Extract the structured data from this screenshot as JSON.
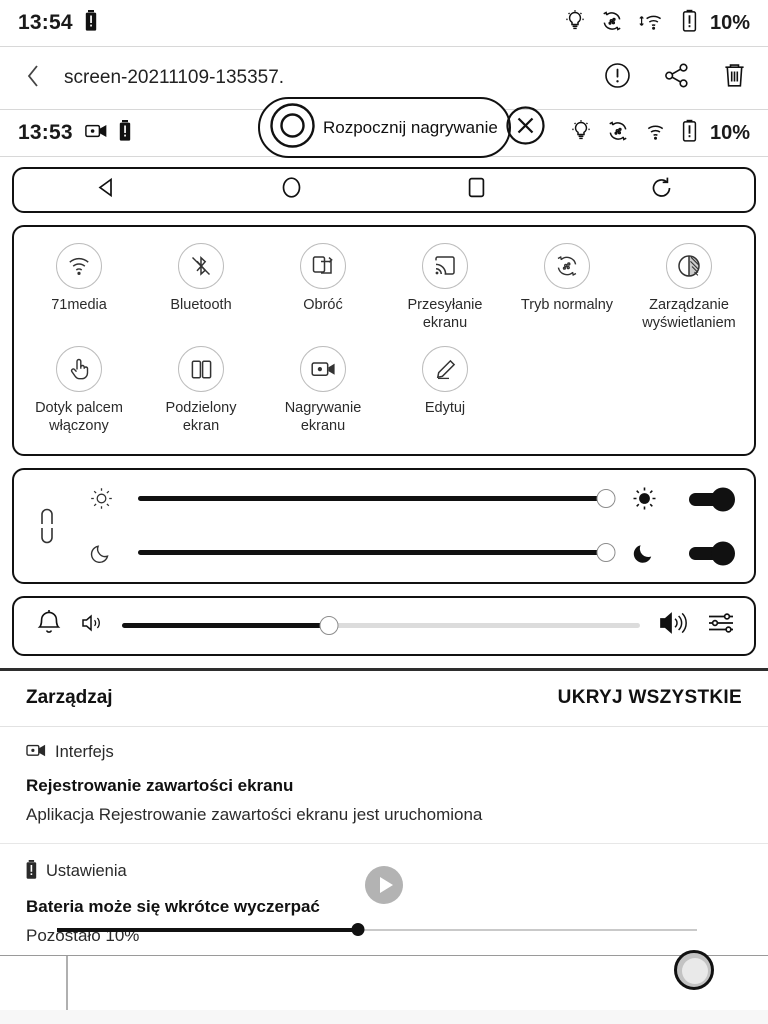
{
  "status_bar_top": {
    "time": "13:54",
    "battery_percent": "10%",
    "icons": [
      "battery-alert-icon",
      "bulb-icon",
      "refresh-mode-icon",
      "wifi-transfer-icon",
      "battery-alert-icon"
    ]
  },
  "toolbar": {
    "back_icon": "chevron-left-icon",
    "title": "screen-20211109-135357.",
    "actions": [
      "info-icon",
      "share-icon",
      "delete-icon"
    ]
  },
  "record_pill": {
    "record_icon": "record-circle-icon",
    "label": "Rozpocznij nagrywanie",
    "close_icon": "close-circle-icon"
  },
  "status_bar_second": {
    "time": "13:53",
    "battery_percent": "10%",
    "left_icons": [
      "screen-record-icon",
      "battery-alert-icon"
    ],
    "right_icons": [
      "bulb-icon",
      "refresh-mode-icon",
      "wifi-icon",
      "battery-alert-icon"
    ]
  },
  "nav_bar": {
    "items": [
      {
        "name": "back-nav-icon"
      },
      {
        "name": "home-nav-icon"
      },
      {
        "name": "recents-nav-icon"
      },
      {
        "name": "refresh-nav-icon"
      }
    ]
  },
  "quick_tiles": [
    {
      "label": "71media",
      "icon": "wifi-icon"
    },
    {
      "label": "Bluetooth",
      "icon": "bluetooth-off-icon"
    },
    {
      "label": "Obróć",
      "icon": "rotate-screen-icon"
    },
    {
      "label": "Przesyłanie\nekranu",
      "label_l1": "Przesyłanie",
      "label_l2": "ekranu",
      "icon": "cast-icon"
    },
    {
      "label": "Tryb normalny",
      "icon": "refresh-mode-icon"
    },
    {
      "label": "Zarządzanie wyświetlaniem",
      "label_l1": "Zarządzanie",
      "label_l2": "wyświetlaniem",
      "icon": "contrast-icon"
    },
    {
      "label": "Dotyk palcem włączony",
      "label_l1": "Dotyk palcem",
      "label_l2": "włączony",
      "icon": "touch-icon"
    },
    {
      "label": "Podzielony ekran",
      "label_l1": "Podzielony",
      "label_l2": "ekran",
      "icon": "split-screen-icon"
    },
    {
      "label": "Nagrywanie ekranu",
      "label_l1": "Nagrywanie",
      "label_l2": "ekranu",
      "icon": "screen-record-icon"
    },
    {
      "label": "Edytuj",
      "icon": "edit-pencil-icon"
    }
  ],
  "brightness": {
    "link_icon": "link-chain-icon",
    "warm": {
      "icon": "sun-outline-icon",
      "value": 100,
      "toggle_icon": "sun-filled-icon",
      "toggle_on": true
    },
    "cool": {
      "icon": "moon-outline-icon",
      "value": 100,
      "toggle_icon": "moon-filled-icon",
      "toggle_on": true
    }
  },
  "volume": {
    "bell_icon": "bell-icon",
    "low_icon": "volume-low-icon",
    "value": 40,
    "high_icon": "volume-high-icon",
    "settings_icon": "sliders-icon"
  },
  "notifications_header": {
    "manage_label": "Zarządzaj",
    "hide_all_label": "UKRYJ WSZYSTKIE"
  },
  "notifications": [
    {
      "app_icon": "screen-record-icon",
      "app_name": "Interfejs",
      "title": "Rejestrowanie zawartości ekranu",
      "body": "Aplikacja Rejestrowanie zawartości ekranu jest uruchomiona"
    },
    {
      "app_icon": "battery-alert-icon",
      "app_name": "Ustawienia",
      "title": "Bateria może się wkrótce wyczerpać",
      "body": "Pozostało 10%"
    }
  ],
  "media_overlay": {
    "play_icon": "play-icon",
    "scrub_percent": 47
  },
  "floating_button": {
    "icon": "fab-circle-icon"
  },
  "colors": {
    "accent": "#111111",
    "panel_border": "#111111",
    "tile_ring": "#bdbdbd",
    "track": "#dcdcdc",
    "separator": "#2e2e2e"
  }
}
